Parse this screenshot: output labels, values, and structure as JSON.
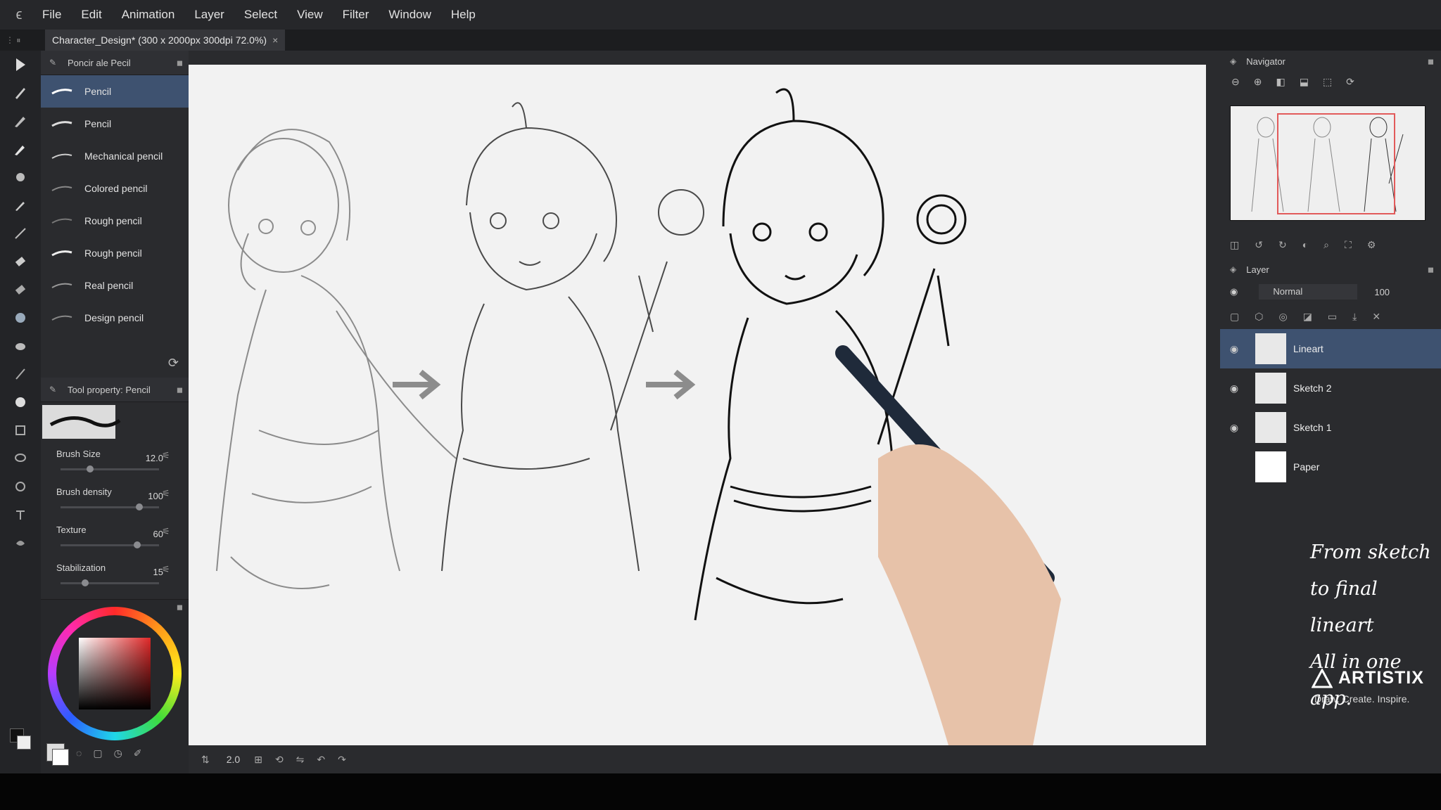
{
  "menu": [
    "File",
    "Edit",
    "Animation",
    "Layer",
    "Select",
    "View",
    "Filter",
    "Window",
    "Help"
  ],
  "document_tab": {
    "title": "Character_Design* (300 x 2000px 300dpi 72.0%)",
    "close": "×"
  },
  "brush_panel": {
    "title": "Poncir ale Pecil",
    "items": [
      {
        "label": "Pencil",
        "selected": true
      },
      {
        "label": "Pencil"
      },
      {
        "label": "Mechanical pencil"
      },
      {
        "label": "Colored pencil"
      },
      {
        "label": "Rough pencil"
      },
      {
        "label": "Rough pencil"
      },
      {
        "label": "Real pencil"
      },
      {
        "label": "Design pencil"
      }
    ]
  },
  "tool_property": {
    "title": "Tool property: Pencil",
    "props": [
      {
        "label": "Brush Size",
        "value": "12.0",
        "level": 0.3
      },
      {
        "label": "Brush density",
        "value": "100",
        "level": 0.8
      },
      {
        "label": "Texture",
        "value": "60",
        "level": 0.78
      },
      {
        "label": "Stabilization",
        "value": "15",
        "level": 0.25
      }
    ]
  },
  "bottom_bar": {
    "zoom": "2.0"
  },
  "navigator": {
    "title": "Navigator"
  },
  "layers": {
    "title": "Layer",
    "blend_mode": "Normal",
    "opacity": "100",
    "items": [
      {
        "name": "Lineart",
        "selected": true
      },
      {
        "name": "Sketch 2"
      },
      {
        "name": "Sketch 1"
      },
      {
        "name": "Paper"
      }
    ]
  },
  "promo": {
    "line1": "From sketch",
    "line2": "to final lineart",
    "line3": "All in one app."
  },
  "brand": {
    "name": "ARTISTIX",
    "tagline": "Draw. Create. Inspire."
  },
  "colors": {
    "accent": "#3e5270",
    "canvas": "#f2f2f2",
    "panel": "#2a2b2e",
    "primary": "#e02828"
  }
}
